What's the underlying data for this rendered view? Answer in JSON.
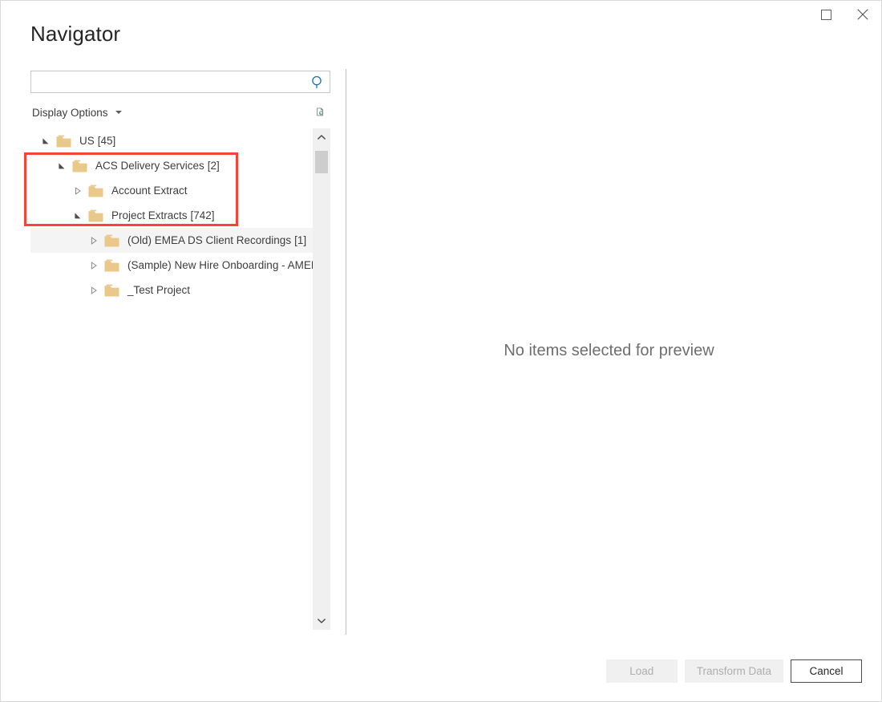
{
  "window": {
    "title": "Navigator",
    "controls": [
      {
        "name": "maximize",
        "icon": "maximize-icon",
        "label": "Maximize"
      },
      {
        "name": "close",
        "icon": "close-icon",
        "label": "Close"
      }
    ]
  },
  "search": {
    "value": "",
    "placeholder": "",
    "icon": "search-icon",
    "icon_color": "#1d6fb8"
  },
  "options": {
    "display_options_label": "Display Options",
    "caret_icon": "chevron-down-icon",
    "refresh_icon": "refresh-document-icon",
    "refresh_accent": "#5aa67e"
  },
  "tree": {
    "folder_color": "#e9c88a",
    "rows": [
      {
        "label": "US",
        "count": "[45]",
        "indent": 0,
        "state": "expanded",
        "hovered": false
      },
      {
        "label": "ACS Delivery Services",
        "count": "[2]",
        "indent": 1,
        "state": "expanded",
        "hovered": false
      },
      {
        "label": "Account Extract",
        "count": "",
        "indent": 2,
        "state": "collapsed",
        "hovered": false
      },
      {
        "label": "Project Extracts",
        "count": "[742]",
        "indent": 2,
        "state": "expanded",
        "hovered": false
      },
      {
        "label": "(Old) EMEA DS Client Recordings",
        "count": "[1]",
        "indent": 3,
        "state": "collapsed",
        "hovered": true
      },
      {
        "label": "(Sample) New Hire Onboarding - AMER",
        "count": "",
        "indent": 3,
        "state": "collapsed",
        "hovered": false
      },
      {
        "label": "_Test Project",
        "count": "",
        "indent": 3,
        "state": "collapsed",
        "hovered": false
      }
    ],
    "scrollbar": {
      "up_icon": "chevron-up-icon",
      "down_icon": "chevron-down-icon",
      "thumb_color": "#cdcdcd"
    }
  },
  "preview": {
    "empty_message": "No items selected for preview"
  },
  "footer": {
    "load_label": "Load",
    "load_enabled": false,
    "transform_label": "Transform Data",
    "transform_enabled": false,
    "cancel_label": "Cancel",
    "cancel_enabled": true
  },
  "annotation": {
    "box_color": "#f9423a",
    "highlights": [
      "ACS Delivery Services",
      "Account Extract",
      "Project Extracts"
    ]
  }
}
